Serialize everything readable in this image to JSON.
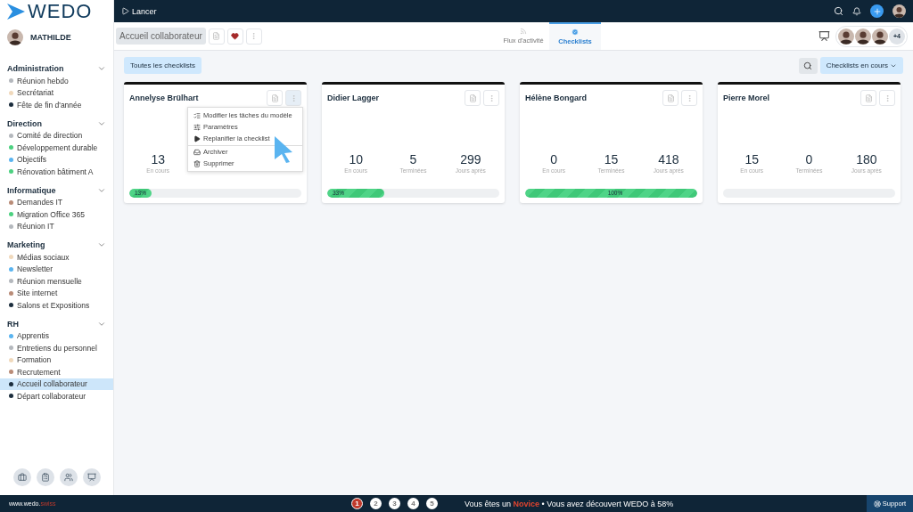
{
  "logo": {
    "text": "WEDO"
  },
  "topbar": {
    "launch": "Lancer"
  },
  "user": {
    "name": "MATHILDE"
  },
  "sidebar": [
    {
      "title": "Administration",
      "expanded": true,
      "items": [
        {
          "label": "Réunion hebdo",
          "color": "#b4b8bd",
          "selected": false
        },
        {
          "label": "Secrétariat",
          "color": "#f0d9bc",
          "selected": false
        },
        {
          "label": "Fête de fin d'année",
          "color": "#1b2d3d",
          "selected": false
        }
      ]
    },
    {
      "title": "Direction",
      "expanded": true,
      "items": [
        {
          "label": "Comité de direction",
          "color": "#b4b8bd",
          "selected": false
        },
        {
          "label": "Développement durable",
          "color": "#4cd180",
          "selected": false
        },
        {
          "label": "Objectifs",
          "color": "#5ab4f0",
          "selected": false
        },
        {
          "label": "Rénovation bâtiment A",
          "color": "#4cd180",
          "selected": false
        }
      ]
    },
    {
      "title": "Informatique",
      "expanded": true,
      "items": [
        {
          "label": "Demandes IT",
          "color": "#b98c78",
          "selected": false
        },
        {
          "label": "Migration Office 365",
          "color": "#4cd180",
          "selected": false
        },
        {
          "label": "Réunion IT",
          "color": "#b4b8bd",
          "selected": false
        }
      ]
    },
    {
      "title": "Marketing",
      "expanded": true,
      "items": [
        {
          "label": "Médias sociaux",
          "color": "#f0d9bc",
          "selected": false
        },
        {
          "label": "Newsletter",
          "color": "#5ab4f0",
          "selected": false
        },
        {
          "label": "Réunion mensuelle",
          "color": "#b4b8bd",
          "selected": false
        },
        {
          "label": "Site internet",
          "color": "#b98c78",
          "selected": false
        },
        {
          "label": "Salons et Expositions",
          "color": "#1b2d3d",
          "selected": false
        }
      ]
    },
    {
      "title": "RH",
      "expanded": true,
      "items": [
        {
          "label": "Apprentis",
          "color": "#5ab4f0",
          "selected": false
        },
        {
          "label": "Entretiens du personnel",
          "color": "#b4b8bd",
          "selected": false
        },
        {
          "label": "Formation",
          "color": "#f0d9bc",
          "selected": false
        },
        {
          "label": "Recrutement",
          "color": "#b98c78",
          "selected": false
        },
        {
          "label": "Accueil collaborateur",
          "color": "#1b2d3d",
          "selected": true
        },
        {
          "label": "Départ collaborateur",
          "color": "#1b2d3d",
          "selected": false
        }
      ]
    }
  ],
  "page": {
    "title": "Accueil collaborateur",
    "favorite": true
  },
  "tabs": [
    {
      "label": "Flux d'activité",
      "selected": false
    },
    {
      "label": "Checklists",
      "selected": true
    }
  ],
  "members_more": "+4",
  "filter": {
    "all": "Toutes les checklists",
    "status": "Checklists en cours"
  },
  "cards": [
    {
      "name": "Annelyse Brülhart",
      "stats": [
        {
          "value": "13",
          "label": "En cours"
        }
      ],
      "level": 0.13,
      "progress_label": "13%",
      "menu_open": true
    },
    {
      "name": "Didier Lagger",
      "stats": [
        {
          "value": "10",
          "label": "En cours"
        },
        {
          "value": "5",
          "label": "Terminées"
        },
        {
          "value": "299",
          "label": "Jours après"
        }
      ],
      "level": 0.33,
      "progress_label": "33%",
      "menu_open": false
    },
    {
      "name": "Hélène Bongard",
      "stats": [
        {
          "value": "0",
          "label": "En cours"
        },
        {
          "value": "15",
          "label": "Terminées"
        },
        {
          "value": "418",
          "label": "Jours après"
        }
      ],
      "level": 1,
      "progress_label": "100%",
      "menu_open": false
    },
    {
      "name": "Pierre Morel",
      "stats": [
        {
          "value": "15",
          "label": "En cours"
        },
        {
          "value": "0",
          "label": "Terminées"
        },
        {
          "value": "180",
          "label": "Jours après"
        }
      ],
      "menu_open": false
    }
  ],
  "menu": [
    {
      "label": "Modifier les tâches du modèle",
      "separated": false
    },
    {
      "label": "Paramètres",
      "separated": false
    },
    {
      "label": "Replanifier la checklist",
      "separated": false
    },
    {
      "label": "Archiver",
      "separated": true
    },
    {
      "label": "Supprimer",
      "separated": false
    }
  ],
  "footer": {
    "site": "www.wedo.",
    "site_tld": "swiss",
    "steps": [
      {
        "label": "1",
        "selected": true
      },
      {
        "label": "2",
        "selected": false
      },
      {
        "label": "3",
        "selected": false
      },
      {
        "label": "4",
        "selected": false
      },
      {
        "label": "5",
        "selected": false
      }
    ],
    "message_start": "Vous êtes un",
    "level_name": "Novice",
    "message_end": "• Vous avez découvert WEDO à 58%",
    "support": "Support"
  }
}
